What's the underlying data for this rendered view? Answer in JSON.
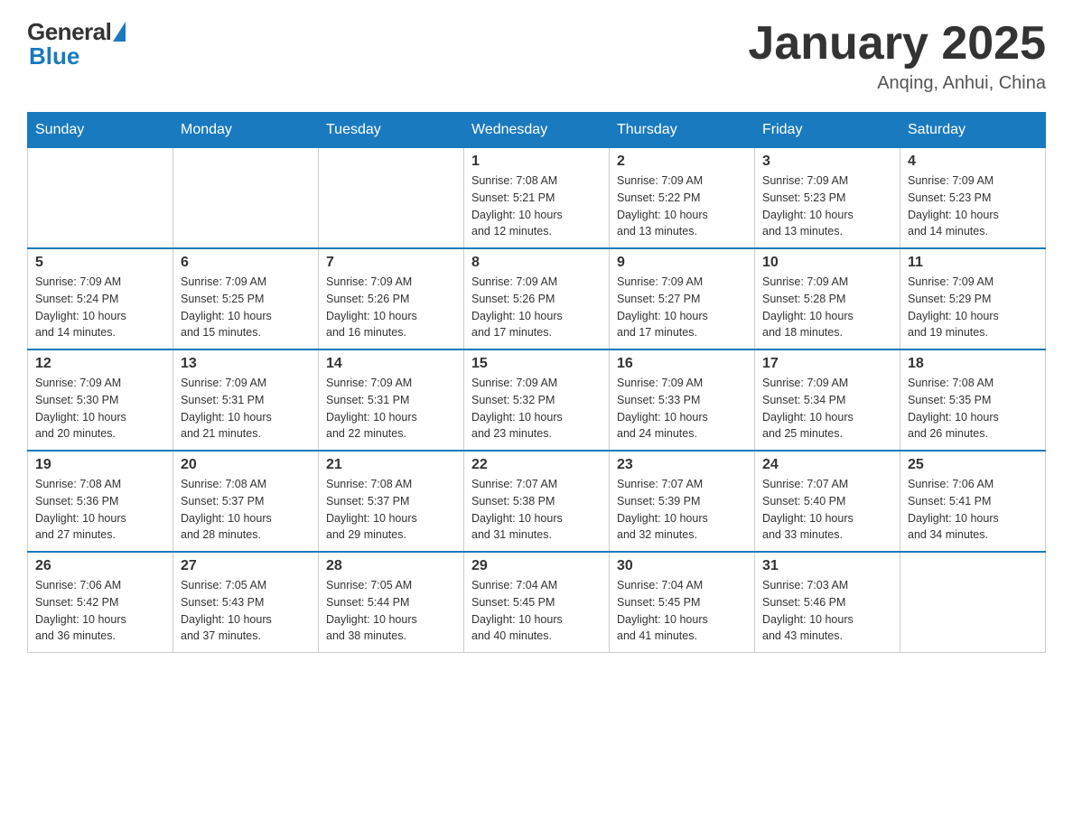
{
  "header": {
    "logo_general": "General",
    "logo_blue": "Blue",
    "title": "January 2025",
    "location": "Anqing, Anhui, China"
  },
  "days_of_week": [
    "Sunday",
    "Monday",
    "Tuesday",
    "Wednesday",
    "Thursday",
    "Friday",
    "Saturday"
  ],
  "weeks": [
    [
      {
        "day": "",
        "info": ""
      },
      {
        "day": "",
        "info": ""
      },
      {
        "day": "",
        "info": ""
      },
      {
        "day": "1",
        "info": "Sunrise: 7:08 AM\nSunset: 5:21 PM\nDaylight: 10 hours\nand 12 minutes."
      },
      {
        "day": "2",
        "info": "Sunrise: 7:09 AM\nSunset: 5:22 PM\nDaylight: 10 hours\nand 13 minutes."
      },
      {
        "day": "3",
        "info": "Sunrise: 7:09 AM\nSunset: 5:23 PM\nDaylight: 10 hours\nand 13 minutes."
      },
      {
        "day": "4",
        "info": "Sunrise: 7:09 AM\nSunset: 5:23 PM\nDaylight: 10 hours\nand 14 minutes."
      }
    ],
    [
      {
        "day": "5",
        "info": "Sunrise: 7:09 AM\nSunset: 5:24 PM\nDaylight: 10 hours\nand 14 minutes."
      },
      {
        "day": "6",
        "info": "Sunrise: 7:09 AM\nSunset: 5:25 PM\nDaylight: 10 hours\nand 15 minutes."
      },
      {
        "day": "7",
        "info": "Sunrise: 7:09 AM\nSunset: 5:26 PM\nDaylight: 10 hours\nand 16 minutes."
      },
      {
        "day": "8",
        "info": "Sunrise: 7:09 AM\nSunset: 5:26 PM\nDaylight: 10 hours\nand 17 minutes."
      },
      {
        "day": "9",
        "info": "Sunrise: 7:09 AM\nSunset: 5:27 PM\nDaylight: 10 hours\nand 17 minutes."
      },
      {
        "day": "10",
        "info": "Sunrise: 7:09 AM\nSunset: 5:28 PM\nDaylight: 10 hours\nand 18 minutes."
      },
      {
        "day": "11",
        "info": "Sunrise: 7:09 AM\nSunset: 5:29 PM\nDaylight: 10 hours\nand 19 minutes."
      }
    ],
    [
      {
        "day": "12",
        "info": "Sunrise: 7:09 AM\nSunset: 5:30 PM\nDaylight: 10 hours\nand 20 minutes."
      },
      {
        "day": "13",
        "info": "Sunrise: 7:09 AM\nSunset: 5:31 PM\nDaylight: 10 hours\nand 21 minutes."
      },
      {
        "day": "14",
        "info": "Sunrise: 7:09 AM\nSunset: 5:31 PM\nDaylight: 10 hours\nand 22 minutes."
      },
      {
        "day": "15",
        "info": "Sunrise: 7:09 AM\nSunset: 5:32 PM\nDaylight: 10 hours\nand 23 minutes."
      },
      {
        "day": "16",
        "info": "Sunrise: 7:09 AM\nSunset: 5:33 PM\nDaylight: 10 hours\nand 24 minutes."
      },
      {
        "day": "17",
        "info": "Sunrise: 7:09 AM\nSunset: 5:34 PM\nDaylight: 10 hours\nand 25 minutes."
      },
      {
        "day": "18",
        "info": "Sunrise: 7:08 AM\nSunset: 5:35 PM\nDaylight: 10 hours\nand 26 minutes."
      }
    ],
    [
      {
        "day": "19",
        "info": "Sunrise: 7:08 AM\nSunset: 5:36 PM\nDaylight: 10 hours\nand 27 minutes."
      },
      {
        "day": "20",
        "info": "Sunrise: 7:08 AM\nSunset: 5:37 PM\nDaylight: 10 hours\nand 28 minutes."
      },
      {
        "day": "21",
        "info": "Sunrise: 7:08 AM\nSunset: 5:37 PM\nDaylight: 10 hours\nand 29 minutes."
      },
      {
        "day": "22",
        "info": "Sunrise: 7:07 AM\nSunset: 5:38 PM\nDaylight: 10 hours\nand 31 minutes."
      },
      {
        "day": "23",
        "info": "Sunrise: 7:07 AM\nSunset: 5:39 PM\nDaylight: 10 hours\nand 32 minutes."
      },
      {
        "day": "24",
        "info": "Sunrise: 7:07 AM\nSunset: 5:40 PM\nDaylight: 10 hours\nand 33 minutes."
      },
      {
        "day": "25",
        "info": "Sunrise: 7:06 AM\nSunset: 5:41 PM\nDaylight: 10 hours\nand 34 minutes."
      }
    ],
    [
      {
        "day": "26",
        "info": "Sunrise: 7:06 AM\nSunset: 5:42 PM\nDaylight: 10 hours\nand 36 minutes."
      },
      {
        "day": "27",
        "info": "Sunrise: 7:05 AM\nSunset: 5:43 PM\nDaylight: 10 hours\nand 37 minutes."
      },
      {
        "day": "28",
        "info": "Sunrise: 7:05 AM\nSunset: 5:44 PM\nDaylight: 10 hours\nand 38 minutes."
      },
      {
        "day": "29",
        "info": "Sunrise: 7:04 AM\nSunset: 5:45 PM\nDaylight: 10 hours\nand 40 minutes."
      },
      {
        "day": "30",
        "info": "Sunrise: 7:04 AM\nSunset: 5:45 PM\nDaylight: 10 hours\nand 41 minutes."
      },
      {
        "day": "31",
        "info": "Sunrise: 7:03 AM\nSunset: 5:46 PM\nDaylight: 10 hours\nand 43 minutes."
      },
      {
        "day": "",
        "info": ""
      }
    ]
  ]
}
